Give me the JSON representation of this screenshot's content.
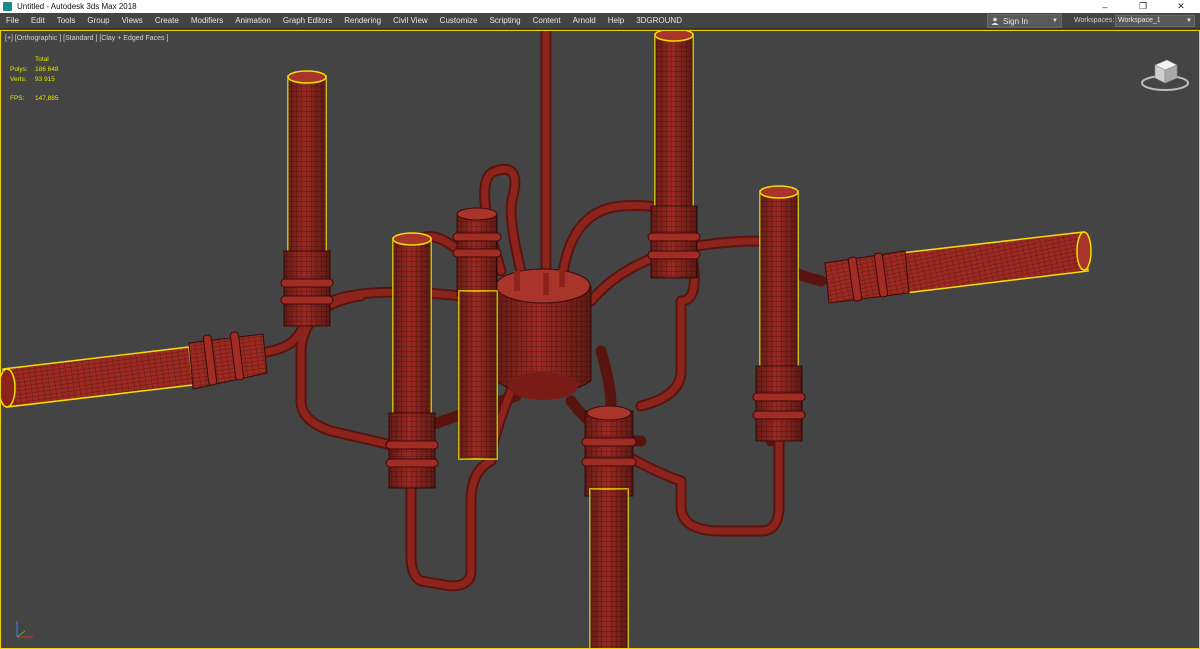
{
  "titlebar": {
    "title": "Untitled - Autodesk 3ds Max 2018",
    "controls": [
      "–",
      "❐",
      "✕"
    ]
  },
  "menubar": {
    "items": [
      "File",
      "Edit",
      "Tools",
      "Group",
      "Views",
      "Create",
      "Modifiers",
      "Animation",
      "Graph Editors",
      "Rendering",
      "Civil View",
      "Customize",
      "Scripting",
      "Content",
      "Arnold",
      "Help",
      "3DGROUND"
    ],
    "signin_label": "Sign In",
    "workspaces_label": "Workspaces:",
    "workspace_value": "Workspace_1"
  },
  "viewport": {
    "label": "[+] [Orthographic ] [Standard ] [Clay + Edged Faces ]",
    "stats": {
      "total_label": "Total",
      "polys_label": "Polys:",
      "polys_value": "186 648",
      "verts_label": "Verts:",
      "verts_value": "93 915",
      "fps_label": "FPS:",
      "fps_value": "147,885"
    }
  },
  "icons": {
    "app": "3dsmax-app-icon",
    "user": "user-icon",
    "dropdown": "dropdown-arrow-icon",
    "viewcube": "viewcube-icon",
    "axis": "axis-tripod-icon"
  },
  "colors": {
    "viewport_bg": "#444444",
    "mesh_fill": "#9a2a22",
    "wire": "#3a0a08",
    "selection_outline": "#f0e000",
    "stats_text": "#e8e800",
    "active_viewport_border": "#f0d000"
  }
}
